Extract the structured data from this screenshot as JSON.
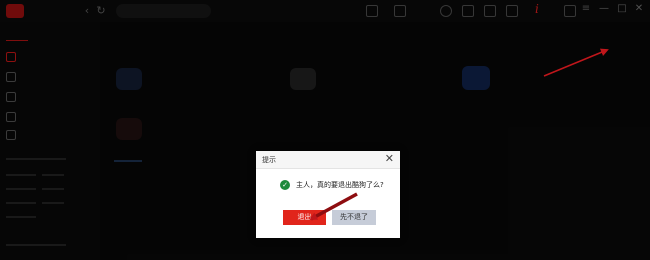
{
  "dialog": {
    "title": "提示",
    "close_glyph": "✕",
    "check_glyph": "✓",
    "message": "主人，真的要退出酷狗了么?",
    "ok_label": "退出",
    "cancel_label": "先不退了"
  },
  "topbar": {
    "back_glyph": "‹",
    "refresh_glyph": "↻",
    "icons": [
      "window-icon",
      "grid-icon",
      "clock-icon",
      "chat-icon",
      "mail-icon",
      "screen-icon"
    ],
    "red_glyph": "i",
    "min_glyph": "—",
    "max_glyph": "□",
    "close_glyph": "✕"
  },
  "colors": {
    "accent": "#e1251b",
    "arrow": "#c0161b",
    "check": "#1e8a3c"
  }
}
